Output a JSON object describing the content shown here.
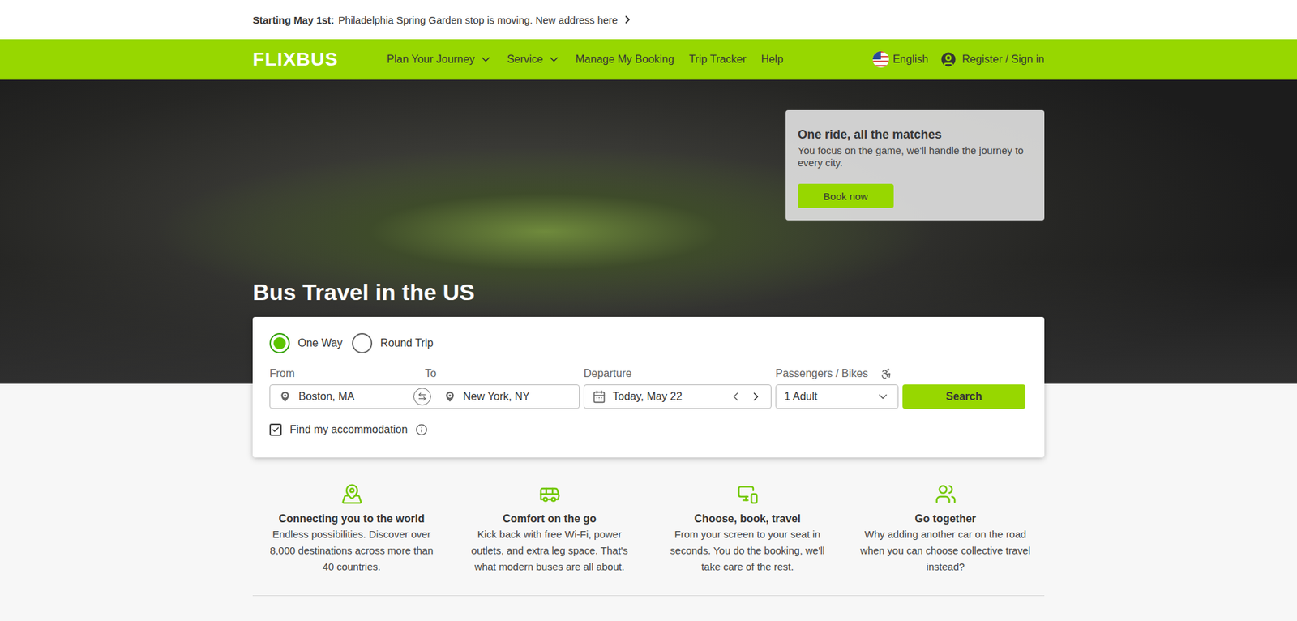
{
  "announcement": {
    "label": "Starting May 1st:",
    "text": "Philadelphia Spring Garden stop is moving. New address here"
  },
  "nav": {
    "logo": "FLIXBUS",
    "items": [
      {
        "label": "Plan Your Journey",
        "dropdown": true
      },
      {
        "label": "Service",
        "dropdown": true
      },
      {
        "label": "Manage My Booking",
        "dropdown": false
      },
      {
        "label": "Trip Tracker",
        "dropdown": false
      },
      {
        "label": "Help",
        "dropdown": false
      }
    ],
    "language": "English",
    "account": "Register / Sign in"
  },
  "hero": {
    "title": "Bus Travel in the US",
    "promo": {
      "title": "One ride, all the matches",
      "text": "You focus on the game, we'll handle the journey to every city.",
      "button": "Book now"
    }
  },
  "search": {
    "trip_types": [
      {
        "label": "One Way",
        "selected": true
      },
      {
        "label": "Round Trip",
        "selected": false
      }
    ],
    "from": {
      "label": "From",
      "value": "Boston, MA"
    },
    "to": {
      "label": "To",
      "value": "New York, NY"
    },
    "departure": {
      "label": "Departure",
      "value": "Today, May 22"
    },
    "passengers": {
      "label": "Passengers / Bikes",
      "value": "1 Adult"
    },
    "button": "Search",
    "accommodation": {
      "label": "Find my accommodation",
      "checked": true
    }
  },
  "features": [
    {
      "title": "Connecting you to the world",
      "text": "Endless possibilities. Discover over 8,000 destinations across more than 40 countries."
    },
    {
      "title": "Comfort on the go",
      "text": "Kick back with free Wi-Fi, power outlets, and extra leg space. That's what modern buses are all about."
    },
    {
      "title": "Choose, book, travel",
      "text": "From your screen to your seat in seconds. You do the booking, we'll take care of the rest."
    },
    {
      "title": "Go together",
      "text": "Why adding another car on the road when you can choose collective travel instead?"
    }
  ]
}
